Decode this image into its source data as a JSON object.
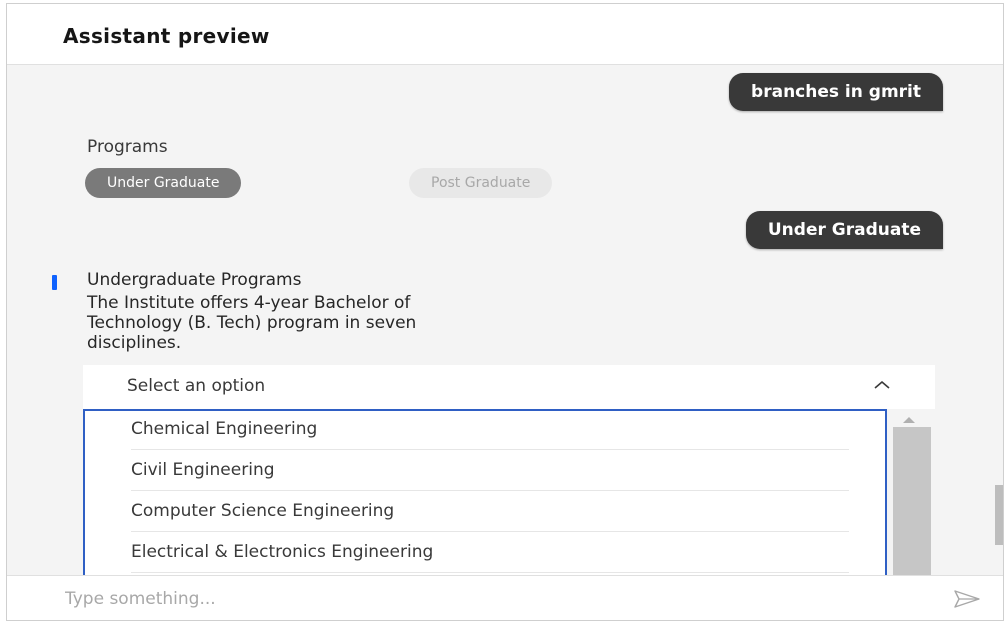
{
  "header": {
    "title": "Assistant preview"
  },
  "messages": {
    "user_1": "branches in gmrit",
    "user_2": "Under Graduate"
  },
  "programs": {
    "label": "Programs",
    "options": [
      "Under Graduate",
      "Post Graduate"
    ],
    "selected": "Under Graduate"
  },
  "undergrad": {
    "title": "Undergraduate Programs",
    "line1": "The Institute offers 4-year Bachelor of",
    "line2": "Technology (B. Tech) program in seven",
    "line3": "disciplines."
  },
  "dropdown": {
    "placeholder": "Select an option",
    "state": "expanded",
    "options": [
      "Chemical Engineering",
      "Civil Engineering",
      "Computer Science Engineering",
      "Electrical & Electronics Engineering"
    ]
  },
  "composer": {
    "placeholder": "Type something..."
  },
  "icons": {
    "dropdown": "chevron-up-icon",
    "send": "send-icon",
    "list_scroll": "caret-up-icon"
  },
  "colors": {
    "user_bubble": "#393939",
    "accent": "#0f62fe",
    "selected_chip": "#7a7a7a",
    "list_border": "#2f5fc4"
  }
}
